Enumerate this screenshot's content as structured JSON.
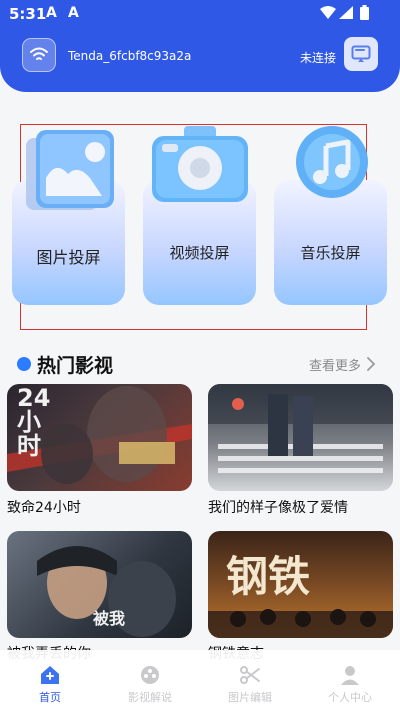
{
  "status_bar": {
    "time": "5:31",
    "indicator_1": "A",
    "indicator_2": "A"
  },
  "header": {
    "ssid": "Tenda_6fcbf8c93a2a",
    "connection_status": "未连接"
  },
  "features": [
    {
      "label": "图片投屏",
      "icon": "image-icon"
    },
    {
      "label": "视频投屏",
      "icon": "camera-icon"
    },
    {
      "label": "音乐投屏",
      "icon": "music-note-icon"
    }
  ],
  "section": {
    "title": "热门影视",
    "more_label": "查看更多"
  },
  "movies": [
    {
      "title": "致命24小时",
      "poster_text": "24小时"
    },
    {
      "title": "我们的样子像极了爱情",
      "poster_text": ""
    },
    {
      "title": "被我弄丢的你",
      "poster_text": "被我"
    },
    {
      "title": "钢铁意志",
      "poster_text": "钢铁"
    }
  ],
  "bottom_nav": [
    {
      "label": "首页",
      "icon": "home-icon",
      "active": true
    },
    {
      "label": "影视解说",
      "icon": "film-icon",
      "active": false
    },
    {
      "label": "图片编辑",
      "icon": "scissors-icon",
      "active": false
    },
    {
      "label": "个人中心",
      "icon": "user-icon",
      "active": false
    }
  ],
  "colors": {
    "header_blue": "#2f58e6",
    "accent_blue": "#2b7cff",
    "highlight_red": "#d6332f"
  }
}
